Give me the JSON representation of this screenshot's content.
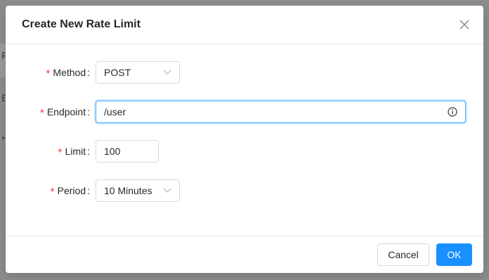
{
  "background": {
    "letters": [
      "F",
      "E",
      "*"
    ]
  },
  "modal": {
    "title": "Create New Rate Limit",
    "close_icon": "close-icon"
  },
  "form": {
    "method": {
      "label": "Method",
      "value": "POST",
      "required": true
    },
    "endpoint": {
      "label": "Endpoint",
      "value": "/user",
      "required": true,
      "icon": "info-circle-icon"
    },
    "limit": {
      "label": "Limit",
      "value": "100",
      "required": true
    },
    "period": {
      "label": "Period",
      "value": "10 Minutes",
      "required": true
    },
    "required_mark": "*",
    "colon": ":"
  },
  "footer": {
    "cancel_label": "Cancel",
    "ok_label": "OK"
  },
  "colors": {
    "primary": "#1890ff",
    "required": "#f5222d",
    "focus_border": "#40a9ff"
  }
}
